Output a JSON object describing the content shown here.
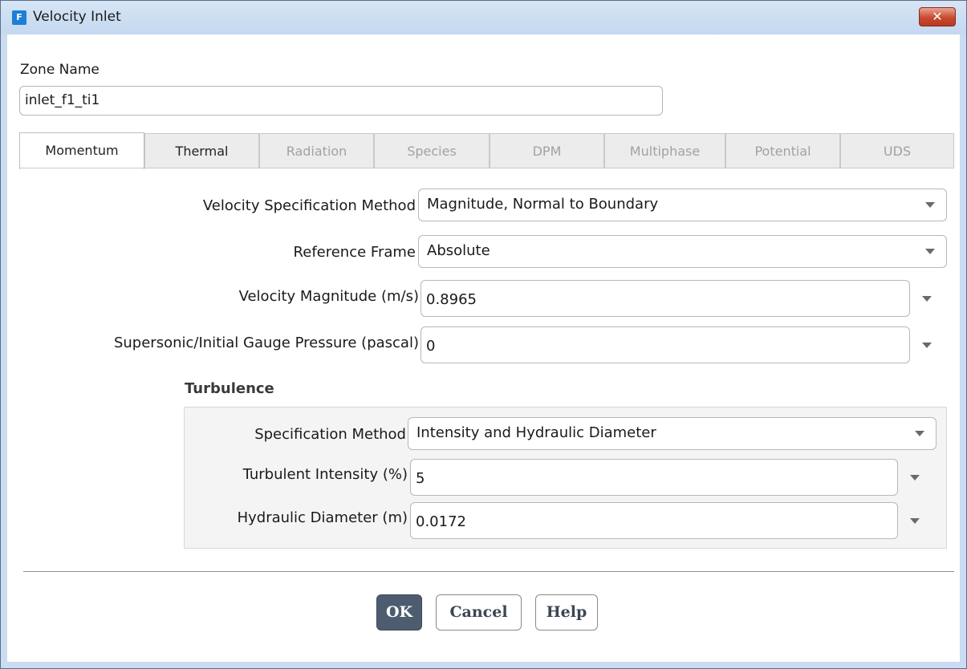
{
  "window": {
    "title": "Velocity Inlet",
    "app_icon_letter": "F",
    "close_symbol": "✕"
  },
  "zone": {
    "label": "Zone Name",
    "value": "inlet_f1_ti1"
  },
  "tabs": [
    {
      "label": "Momentum",
      "state": "active"
    },
    {
      "label": "Thermal",
      "state": "enabled"
    },
    {
      "label": "Radiation",
      "state": "disabled"
    },
    {
      "label": "Species",
      "state": "disabled"
    },
    {
      "label": "DPM",
      "state": "disabled"
    },
    {
      "label": "Multiphase",
      "state": "disabled"
    },
    {
      "label": "Potential",
      "state": "disabled"
    },
    {
      "label": "UDS",
      "state": "disabled"
    }
  ],
  "momentum": {
    "velocity_spec_method": {
      "label": "Velocity Specification Method",
      "value": "Magnitude, Normal to Boundary"
    },
    "reference_frame": {
      "label": "Reference Frame",
      "value": "Absolute"
    },
    "velocity_magnitude": {
      "label": "Velocity Magnitude (m/s)",
      "value": "0.8965"
    },
    "gauge_pressure": {
      "label": "Supersonic/Initial Gauge Pressure (pascal)",
      "value": "0"
    }
  },
  "turbulence": {
    "header": "Turbulence",
    "spec_method": {
      "label": "Specification Method",
      "value": "Intensity and Hydraulic Diameter"
    },
    "intensity": {
      "label": "Turbulent Intensity (%)",
      "value": "5"
    },
    "hydraulic_diameter": {
      "label": "Hydraulic Diameter (m)",
      "value": "0.0172"
    }
  },
  "buttons": {
    "ok": "OK",
    "cancel": "Cancel",
    "help": "Help"
  }
}
